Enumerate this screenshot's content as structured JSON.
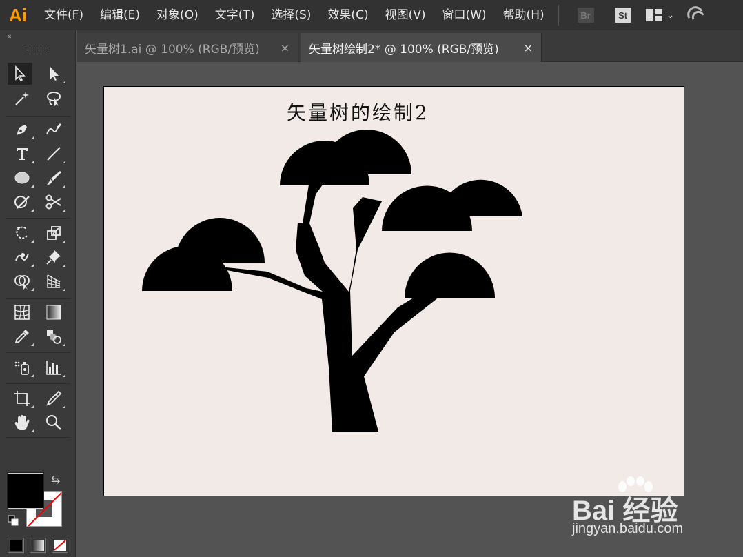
{
  "app": {
    "logo_text": "Ai",
    "menu": [
      "文件(F)",
      "编辑(E)",
      "对象(O)",
      "文字(T)",
      "选择(S)",
      "效果(C)",
      "视图(V)",
      "窗口(W)",
      "帮助(H)"
    ],
    "badges": {
      "bridge": "Br",
      "stock": "St"
    },
    "icons": {
      "workspace": "workspace-grid-icon",
      "sync": "sync-icon"
    }
  },
  "tabs": [
    {
      "label": "矢量树1.ai @ 100% (RGB/预览)",
      "close": "×",
      "active": false
    },
    {
      "label": "矢量树绘制2* @ 100% (RGB/预览)",
      "close": "×",
      "active": true
    }
  ],
  "tools": {
    "collapse_glyph": "‹‹",
    "items": [
      "selection",
      "direct-selection",
      "magic-wand",
      "lasso",
      "pen",
      "curvature",
      "type",
      "line-segment",
      "ellipse",
      "paintbrush",
      "shaper",
      "scissors",
      "rotate",
      "scale",
      "warp",
      "puppet-warp",
      "shape-builder",
      "perspective-grid",
      "mesh",
      "gradient",
      "eyedropper",
      "blend",
      "symbol-sprayer",
      "column-graph",
      "artboard",
      "slice",
      "hand",
      "zoom"
    ],
    "fill_color": "#000000",
    "stroke_color": "none",
    "swap_glyph": "⇆"
  },
  "artboard": {
    "title": "矢量树的绘制2",
    "background": "#f2eae6",
    "art_color": "#000000"
  },
  "watermark": {
    "brand": "Bai 经验",
    "url": "jingyan.baidu.com"
  }
}
